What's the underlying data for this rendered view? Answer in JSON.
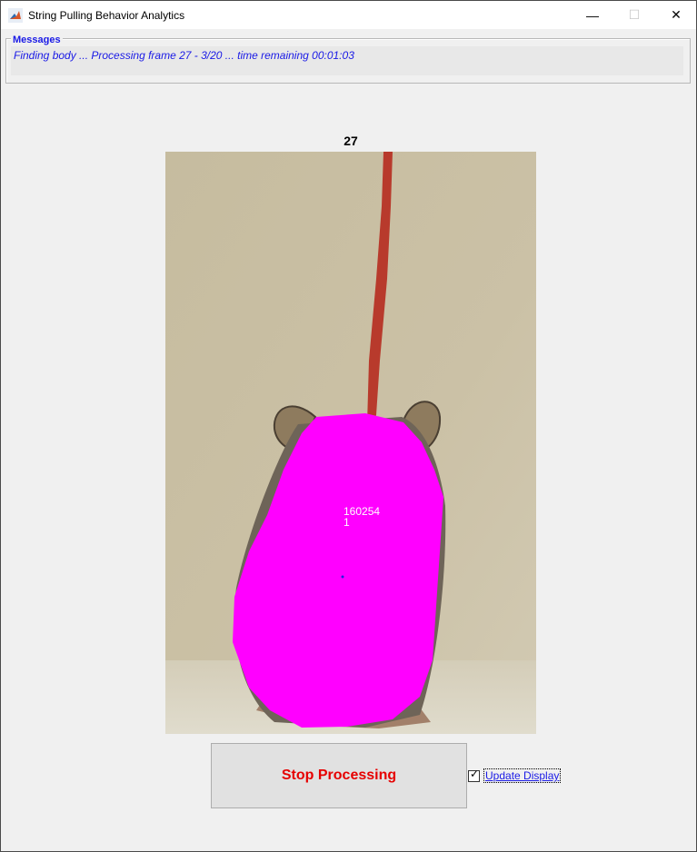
{
  "window": {
    "title": "String Pulling Behavior Analytics",
    "controls": {
      "minimize": "—",
      "maximize": "☐",
      "close": "✕"
    }
  },
  "messages": {
    "legend": "Messages",
    "text": "Finding body ... Processing frame 27 - 3/20 ... time remaining 00:01:03"
  },
  "frame": {
    "number": "27",
    "overlay_value": "160254",
    "overlay_index": "1"
  },
  "controls": {
    "stop_label": "Stop Processing",
    "update_display_label": "Update Display",
    "update_display_checked": true
  },
  "colors": {
    "message_blue": "#1a1ae6",
    "stop_red": "#e60000",
    "mask_magenta": "#ff00ff",
    "string_red": "#b83a2c",
    "background_tan": "#c8bda0"
  }
}
